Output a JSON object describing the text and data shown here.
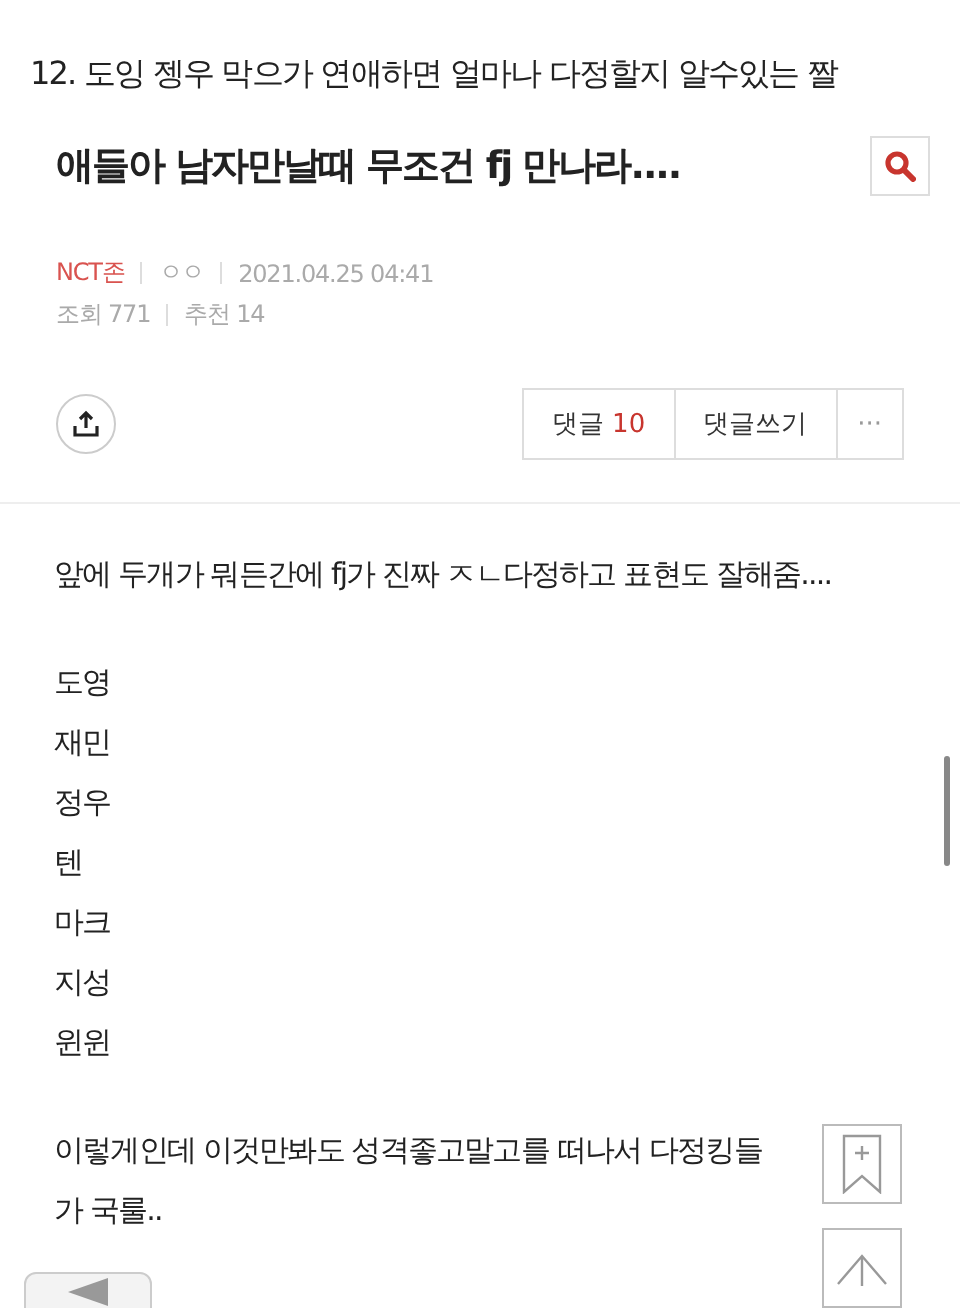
{
  "headline": "12. 도잉 젱우 막으가 연애하면 얼마나 다정할지 알수있는 짤",
  "post": {
    "title": "애들아 남자만날때 무조건 fj 만나라....",
    "board": "NCT존",
    "author": "ㅇㅇ",
    "date": "2021.04.25 04:41",
    "views": "조회 771",
    "likes": "추천 14"
  },
  "actions": {
    "comments_label": "댓글",
    "comments_count": "10",
    "write": "댓글쓰기",
    "more": "···"
  },
  "body": [
    [
      "앞에 두개가 뭐든간에 fj가 진짜 ㅈㄴ다정하고 표현도 잘해줌...."
    ],
    [
      "도영",
      "재민",
      "정우",
      "텐",
      "마크",
      "지성",
      "윈윈"
    ],
    [
      "이렇게인데 이것만봐도 성격좋고말고를 떠나서 다정킹들",
      "가 국룰.."
    ]
  ]
}
